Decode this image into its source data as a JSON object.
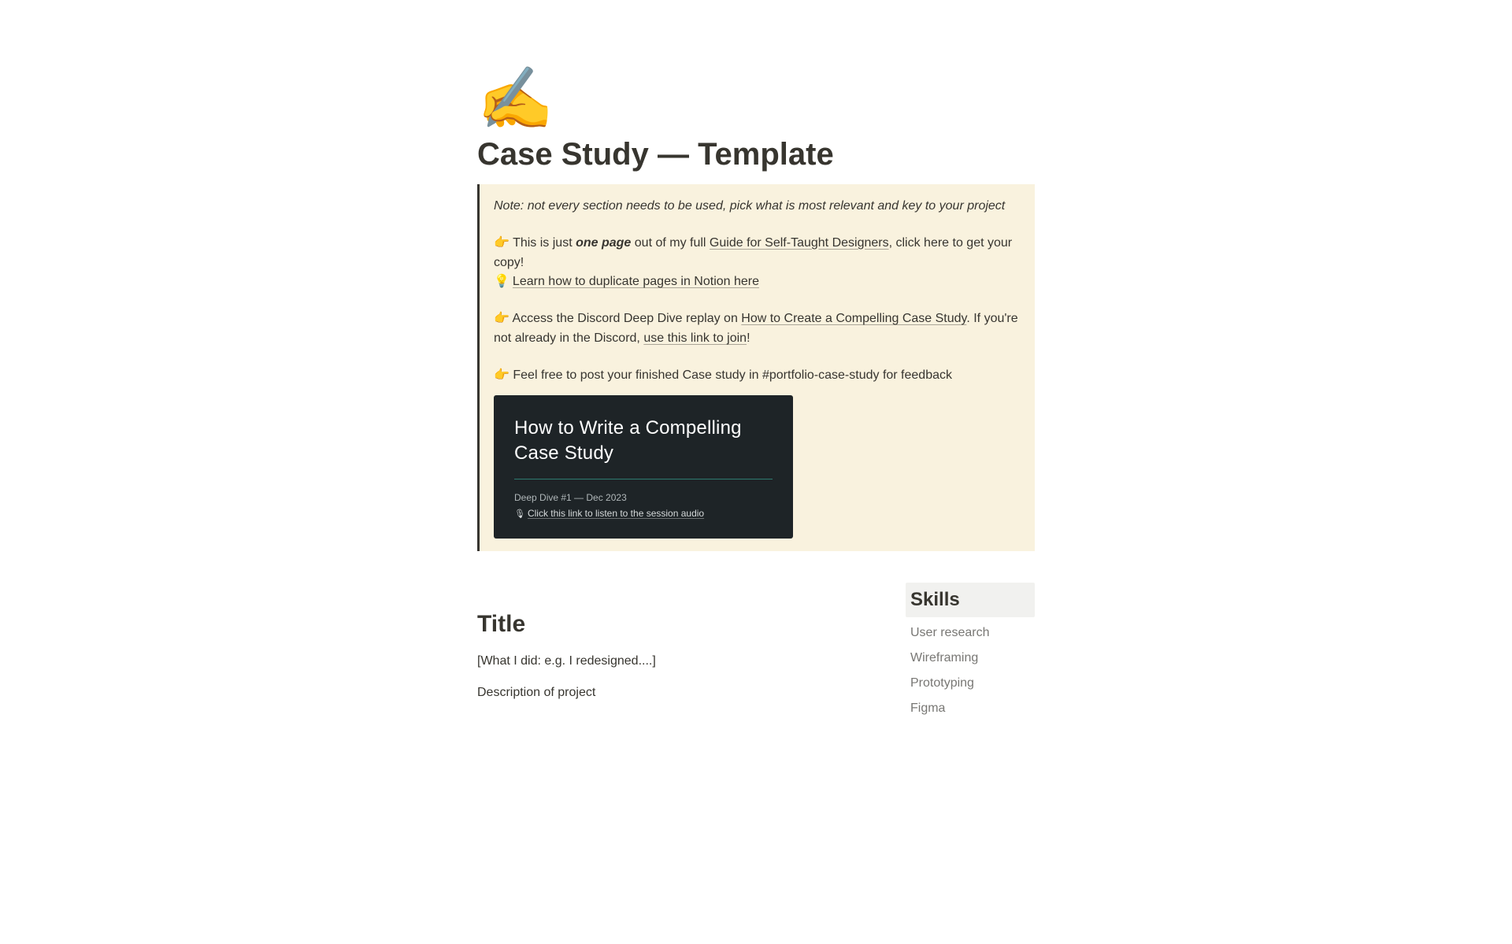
{
  "icon": "✍️",
  "title": "Case Study — Template",
  "callout": {
    "note": "Note: not every section needs to be used, pick what is most relevant and key to your project",
    "line1": {
      "pre": "👉 This is just ",
      "em": "one page",
      "mid": " out of my full ",
      "link": "Guide for Self-Taught Designers",
      "post": ", click here to get your copy!"
    },
    "line2": {
      "emoji": "💡",
      "link": "Learn how to duplicate pages in Notion here"
    },
    "line3": {
      "pre": "👉 Access the Discord Deep Dive replay on ",
      "link1": "How to Create a Compelling Case Study",
      "mid": ". If you're not already in the Discord, ",
      "link2": "use this link to join",
      "post": "!"
    },
    "line4": "👉 Feel free to post your finished Case study in #portfolio-case-study for feedback"
  },
  "embed": {
    "title": "How to Write a Compelling Case Study",
    "meta": "Deep Dive #1 — Dec 2023",
    "audio_link": "Click this link to listen to the session audio"
  },
  "main": {
    "title_heading": "Title",
    "subtitle": "[What I did: e.g. I redesigned....]",
    "description": "Description of project"
  },
  "skills": {
    "heading": "Skills",
    "items": [
      "User research",
      "Wireframing",
      "Prototyping",
      "Figma"
    ]
  }
}
